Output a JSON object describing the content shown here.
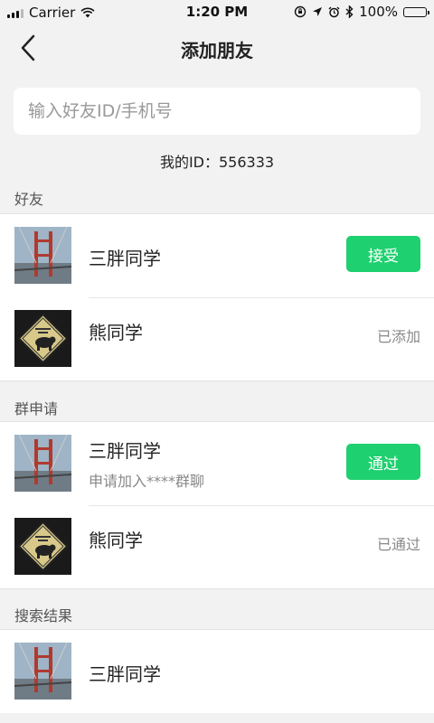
{
  "status_bar": {
    "carrier": "Carrier",
    "time": "1:20 PM",
    "battery": "100%"
  },
  "nav": {
    "title": "添加朋友"
  },
  "search": {
    "placeholder": "输入好友ID/手机号"
  },
  "my_id": "我的ID：556333",
  "friends": {
    "label": "好友",
    "items": [
      {
        "name": "三胖同学",
        "action": "接受"
      },
      {
        "name": "熊同学",
        "status": "已添加"
      }
    ]
  },
  "group_requests": {
    "label": "群申请",
    "items": [
      {
        "name": "三胖同学",
        "subtitle": "申请加入****群聊",
        "action": "通过"
      },
      {
        "name": "熊同学",
        "status": "已通过"
      }
    ]
  },
  "search_results": {
    "label": "搜索结果",
    "items": [
      {
        "name": "三胖同学"
      }
    ]
  },
  "colors": {
    "accent": "#1ed06f",
    "background": "#f2f2f2"
  }
}
